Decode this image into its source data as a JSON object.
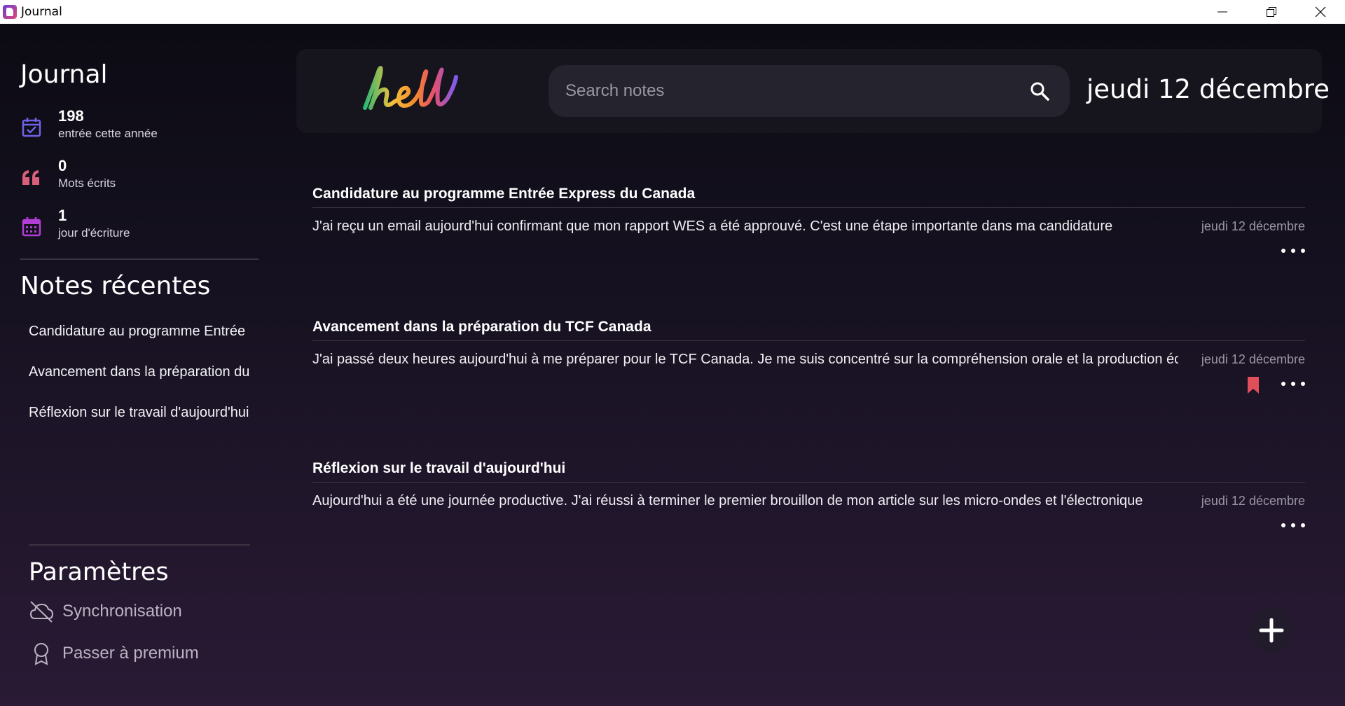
{
  "window": {
    "title": "Journal"
  },
  "sidebar": {
    "title": "Journal",
    "stats": [
      {
        "value": "198",
        "label": "entrée cette année",
        "icon": "calendar-check-icon",
        "color": "#6f63e8"
      },
      {
        "value": "0",
        "label": "Mots écrits",
        "icon": "quote-icon",
        "color": "#d9607a"
      },
      {
        "value": "1",
        "label": "jour d'écriture",
        "icon": "calendar-grid-icon",
        "color": "#b13fd6"
      }
    ],
    "recent_title": "Notes récentes",
    "recent": [
      "Candidature au programme Entrée Express du Canada",
      "Avancement dans la préparation du TCF Canada",
      "Réflexion sur le travail d'aujourd'hui"
    ],
    "settings_title": "Paramètres",
    "settings": [
      {
        "label": "Synchronisation",
        "icon": "cloud-off-icon"
      },
      {
        "label": "Passer à premium",
        "icon": "award-icon"
      }
    ]
  },
  "header": {
    "logo_text": "hell",
    "search_placeholder": "Search notes",
    "date": "jeudi 12 décembre"
  },
  "notes": [
    {
      "title": "Candidature au programme Entrée Express du Canada",
      "body": "J'ai reçu un email aujourd'hui confirmant que mon rapport WES a été approuvé. C'est une étape importante dans ma candidature",
      "date": "jeudi 12 décembre",
      "bookmarked": false
    },
    {
      "title": "Avancement dans la préparation du TCF Canada",
      "body": "J'ai passé deux heures aujourd'hui à me préparer pour le TCF Canada. Je me suis concentré sur la compréhension orale et la production écrite",
      "date": "jeudi 12 décembre",
      "bookmarked": true
    },
    {
      "title": "Réflexion sur le travail d'aujourd'hui",
      "body": "Aujourd'hui a été une journée productive. J'ai réussi à terminer le premier brouillon de mon article sur les micro-ondes et l'électronique",
      "date": "jeudi 12 décembre",
      "bookmarked": false
    }
  ],
  "colors": {
    "bookmark": "#e0505a",
    "accent": "#6f63e8"
  }
}
